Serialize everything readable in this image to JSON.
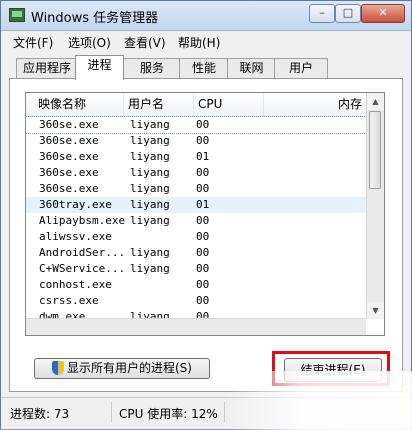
{
  "window": {
    "title": "Windows 任务管理器",
    "minimize": "–",
    "maximize": "□",
    "close": "✕"
  },
  "menu": [
    "文件(F)",
    "选项(O)",
    "查看(V)",
    "帮助(H)"
  ],
  "tabs": [
    "应用程序",
    "进程",
    "服务",
    "性能",
    "联网",
    "用户"
  ],
  "columns": [
    "映像名称",
    "用户名",
    "CPU",
    "内存"
  ],
  "processes": [
    {
      "name": "360se.exe",
      "user": "liyang",
      "cpu": "00"
    },
    {
      "name": "360se.exe",
      "user": "liyang",
      "cpu": "00"
    },
    {
      "name": "360se.exe",
      "user": "liyang",
      "cpu": "01"
    },
    {
      "name": "360se.exe",
      "user": "liyang",
      "cpu": "00"
    },
    {
      "name": "360se.exe",
      "user": "liyang",
      "cpu": "00"
    },
    {
      "name": "360tray.exe",
      "user": "liyang",
      "cpu": "01"
    },
    {
      "name": "Alipaybsm.exe",
      "user": "liyang",
      "cpu": "00"
    },
    {
      "name": "aliwssv.exe",
      "user": "",
      "cpu": "00"
    },
    {
      "name": "AndroidSer...",
      "user": "liyang",
      "cpu": "00"
    },
    {
      "name": "C+WService...",
      "user": "liyang",
      "cpu": "00"
    },
    {
      "name": "conhost.exe",
      "user": "",
      "cpu": "00"
    },
    {
      "name": "csrss.exe",
      "user": "",
      "cpu": "00"
    },
    {
      "name": "dwm.exe",
      "user": "liyang",
      "cpu": "00"
    }
  ],
  "buttons": {
    "show_all": "显示所有用户的进程(S)",
    "end_process": "结束进程(E)"
  },
  "status": {
    "process_count": "进程数: 73",
    "cpu_usage": "CPU 使用率: 12%"
  },
  "scroll": {
    "up": "▲",
    "down": "▼"
  }
}
